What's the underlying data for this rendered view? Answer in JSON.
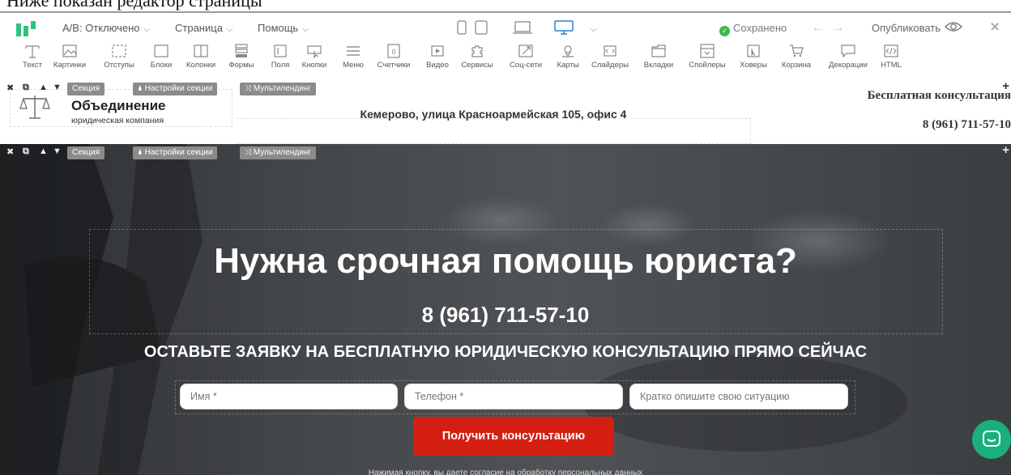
{
  "top_strip": {
    "text": "Ниже показан редактор страницы"
  },
  "topbar": {
    "ab_test": "A/B: Отключено",
    "page": "Страница",
    "help": "Помощь",
    "status": "Сохранено",
    "publish": "Опубликовать"
  },
  "toolbar": {
    "items": [
      "Текст",
      "Картинки",
      "Отступы",
      "Блоки",
      "Колонки",
      "Формы",
      "Поля",
      "Кнопки",
      "Меню",
      "Счетчики",
      "Видео",
      "Сервисы",
      "Соц-сети",
      "Карты",
      "Слайдеры",
      "Вкладки",
      "Спойлеры",
      "Ховеры",
      "Корзина",
      "Декорации",
      "HTML"
    ]
  },
  "section_bar": {
    "section": "Секция",
    "settings": "Настройки секции",
    "multilanding": "Мультилендинг"
  },
  "header": {
    "company_name": "Объединение",
    "company_sub": "юридическая компания",
    "address": "Кемерово, улица Красноармейская 105, офис 4",
    "consult": "Бесплатная консультация",
    "phone": "8 (961) 711-57-10"
  },
  "hero": {
    "title": "Нужна срочная помощь юриста?",
    "phone": "8 (961) 711-57-10",
    "subtitle": "ОСТАВЬТЕ ЗАЯВКУ НА БЕСПЛАТНУЮ ЮРИДИЧЕСКУЮ КОНСУЛЬТАЦИЮ ПРЯМО СЕЙЧАС",
    "name_placeholder": "Имя *",
    "phone_placeholder": "Телефон *",
    "situation_placeholder": "Кратко опишите свою ситуацию",
    "button": "Получить консультацию",
    "consent": "Нажимая кнопку, вы даете согласие на обработку персональных данных"
  },
  "colors": {
    "accent_green": "#2ec27e",
    "device_active_blue": "#2f7cd8",
    "saved_green": "#40b64a",
    "cta_red": "#d51e12",
    "chat_teal": "#19b07c"
  }
}
